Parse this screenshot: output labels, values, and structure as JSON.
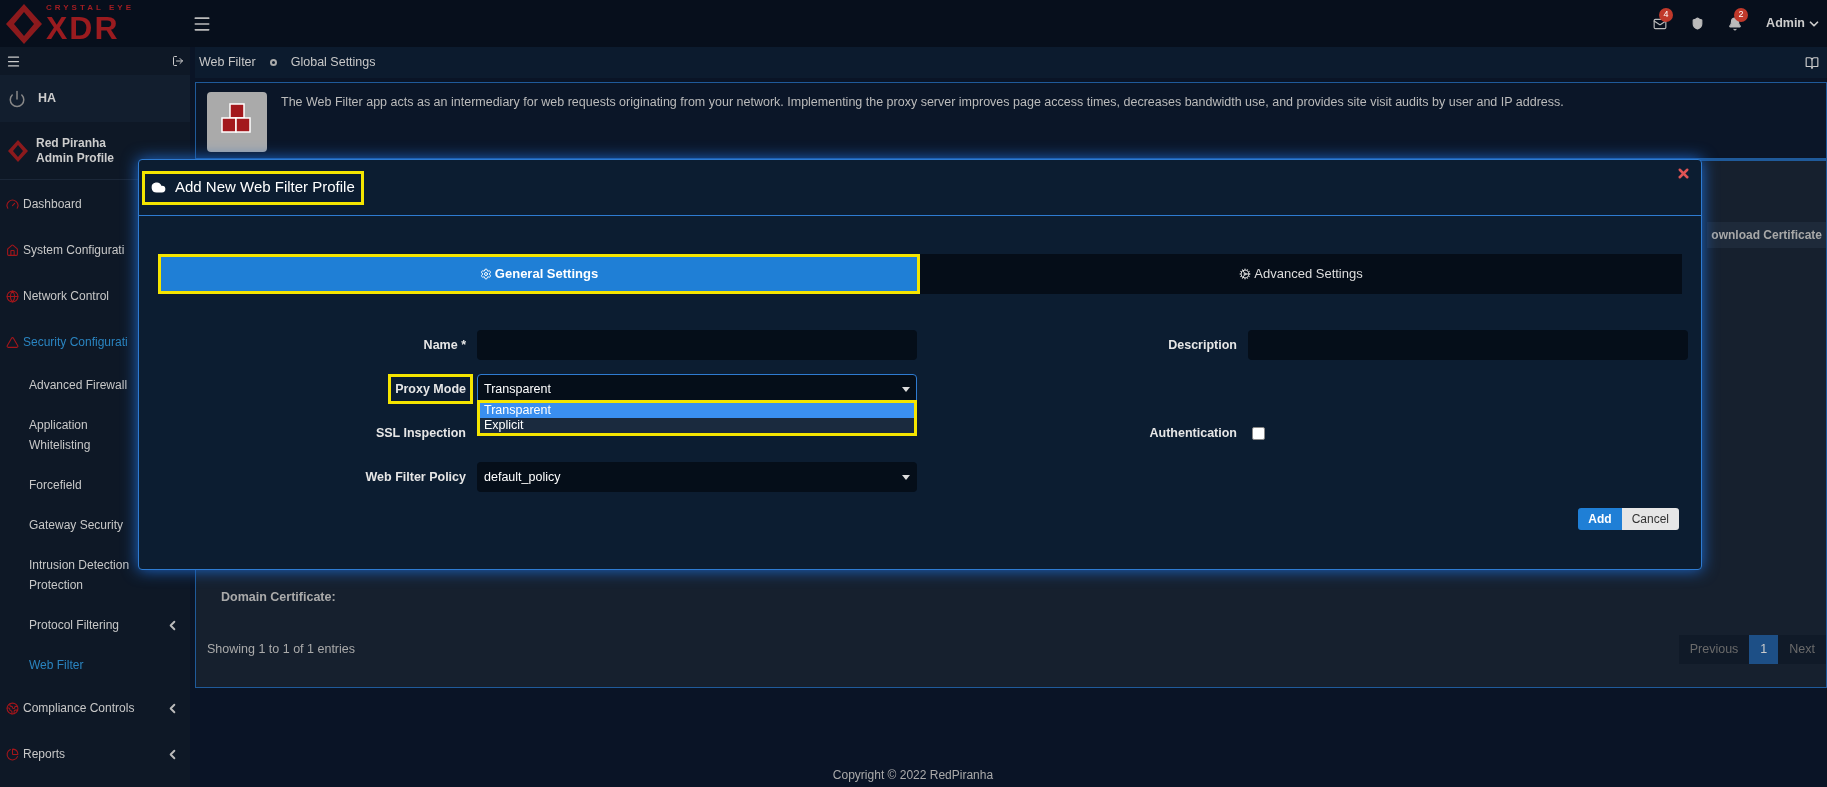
{
  "header": {
    "logo_top": "CRYSTAL EYE",
    "logo_main": "XDR",
    "mail_count": "4",
    "alert_count": "2",
    "user": "Admin"
  },
  "sidebar": {
    "ha": "HA",
    "profile": {
      "name": "Red Piranha",
      "role": "Admin Profile"
    },
    "items": [
      {
        "label": "Dashboard",
        "selected": false
      },
      {
        "label": "System Configurati",
        "selected": false
      },
      {
        "label": "Network Control",
        "selected": false
      },
      {
        "label": "Security Configurati",
        "selected": true,
        "children": [
          {
            "label": "Advanced Firewall",
            "selected": false
          },
          {
            "label": "Application Whitelisting",
            "selected": false
          },
          {
            "label": "Forcefield",
            "selected": false
          },
          {
            "label": "Gateway Security",
            "selected": false
          },
          {
            "label": "Intrusion Detection Protection",
            "selected": false
          },
          {
            "label": "Protocol Filtering",
            "selected": false,
            "caret": true
          },
          {
            "label": "Web Filter",
            "selected": true,
            "caret": false
          }
        ]
      },
      {
        "label": "Compliance Controls",
        "selected": false,
        "caret": true
      },
      {
        "label": "Reports",
        "selected": false,
        "caret": true
      }
    ]
  },
  "breadcrumb": [
    "Web Filter",
    "Global Settings"
  ],
  "info": "The Web Filter app acts as an intermediary for web requests originating from your network. Implementing the proxy server improves page access times, decreases bandwidth use, and provides site visit audits by user and IP address.",
  "panel": {
    "download_button": "ownload Certificate",
    "domain_certificate": "Domain Certificate:",
    "entries": "Showing 1 to 1 of 1 entries",
    "pagination": [
      {
        "label": "Previous",
        "selected": false
      },
      {
        "label": "1",
        "selected": true
      },
      {
        "label": "Next",
        "selected": false
      }
    ]
  },
  "footer": "Copyright © 2022 RedPiranha",
  "modal": {
    "title": {
      "text": "Add New Web Filter Profile",
      "highlighted": true
    },
    "tabs": [
      {
        "label": "General Settings",
        "selected": true,
        "highlighted": true
      },
      {
        "label": "Advanced Settings",
        "selected": false,
        "highlighted": false
      }
    ],
    "rows": [
      {
        "left": {
          "kind": "text",
          "label": "Name *",
          "highlighted": false
        },
        "right": {
          "kind": "text",
          "label": "Description",
          "highlighted": false
        }
      },
      {
        "left": {
          "kind": "select",
          "label": "Proxy Mode",
          "value": "Transparent",
          "highlighted": true,
          "expanded": true,
          "options": [
            {
              "label": "Transparent",
              "selected": true
            },
            {
              "label": "Explicit",
              "selected": false
            }
          ]
        }
      },
      {
        "left": {
          "kind": "label",
          "label": "SSL Inspection",
          "highlighted": false
        },
        "right": {
          "kind": "checkbox",
          "label": "Authentication",
          "checked": false,
          "highlighted": false
        }
      },
      {
        "left": {
          "kind": "select",
          "label": "Web Filter Policy",
          "value": "default_policy",
          "highlighted": false,
          "expanded": false
        }
      }
    ],
    "buttons": [
      {
        "kind": "primary",
        "label": "Add"
      },
      {
        "kind": "secondary",
        "label": "Cancel"
      }
    ]
  }
}
